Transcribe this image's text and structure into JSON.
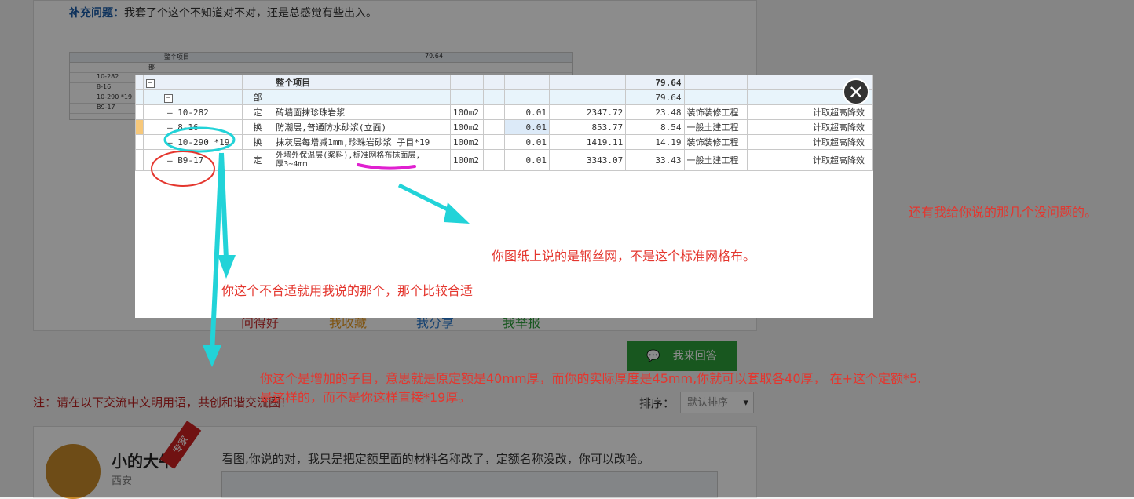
{
  "supplement": {
    "label": "补充问题：",
    "text": "我套了个这个不知道对不对，还是总感觉有些出入。"
  },
  "thumb": {
    "header": "整个项目",
    "header_value": "79.64",
    "rows": [
      "部",
      "10-282",
      "8-16",
      "10-290 *19",
      "B9-17"
    ]
  },
  "table": {
    "header_name": "整个项目",
    "header_total": "79.64",
    "bu_type": "部",
    "bu_total": "79.64",
    "rows": [
      {
        "code": "10-282",
        "type": "定",
        "name": "砖墙面抹珍珠岩浆",
        "unit": "100m2",
        "qty": "0.01",
        "price": "2347.72",
        "total": "23.48",
        "category": "装饰装修工程",
        "note": "计取超高降效"
      },
      {
        "code": "8-16",
        "type": "换",
        "name": "防潮层,普通防水砂浆(立面)",
        "unit": "100m2",
        "qty": "0.01",
        "price": "853.77",
        "total": "8.54",
        "category": "一般土建工程",
        "note": "计取超高降效"
      },
      {
        "code": "10-290 *19",
        "type": "换",
        "name": "抹灰层每增减1mm,珍珠岩砂浆 子目*19",
        "unit": "100m2",
        "qty": "0.01",
        "price": "1419.11",
        "total": "14.19",
        "category": "装饰装修工程",
        "note": "计取超高降效"
      },
      {
        "code": "B9-17",
        "type": "定",
        "name": "外墙外保温层(浆料),标准网格布抹面层,",
        "name2": "厚3~4mm",
        "unit": "100m2",
        "qty": "0.01",
        "price": "3343.07",
        "total": "33.43",
        "category": "一般土建工程",
        "note": "计取超高降效"
      }
    ]
  },
  "annotations": {
    "steel_mesh": "你图纸上说的是钢丝网，不是这个标准网格布。",
    "not_suitable": "你这个不合适就用我说的那个，那个比较合适",
    "others_ok": "还有我给你说的那几个没问题的。",
    "added_line1": "你这个是增加的子目，意思就是原定额是40mm厚，而你的实际厚度是45mm,你就可以套取各40厚， 在+这个定额*5.",
    "added_line2": "是这样的，而不是你这样直接*19厚。"
  },
  "links": [
    "问得好",
    "我收藏",
    "我分享",
    "我举报"
  ],
  "answer_button": "我来回答",
  "note": "注：请在以下交流中文明用语，共创和谐交流圈！",
  "sort": {
    "label": "排序：",
    "selected": "默认排序"
  },
  "user": {
    "name": "小的大牛",
    "city": "西安",
    "badge": "专家",
    "reply": "看图,你说的对，我只是把定额里面的材料名称改了，定额名称没改，你可以改哈。"
  },
  "colors": {
    "annotation_red": "#e4362e",
    "arrow_cyan": "#22d3d8",
    "highlight_magenta": "#e020d0",
    "button_green": "#2c9e3a"
  }
}
